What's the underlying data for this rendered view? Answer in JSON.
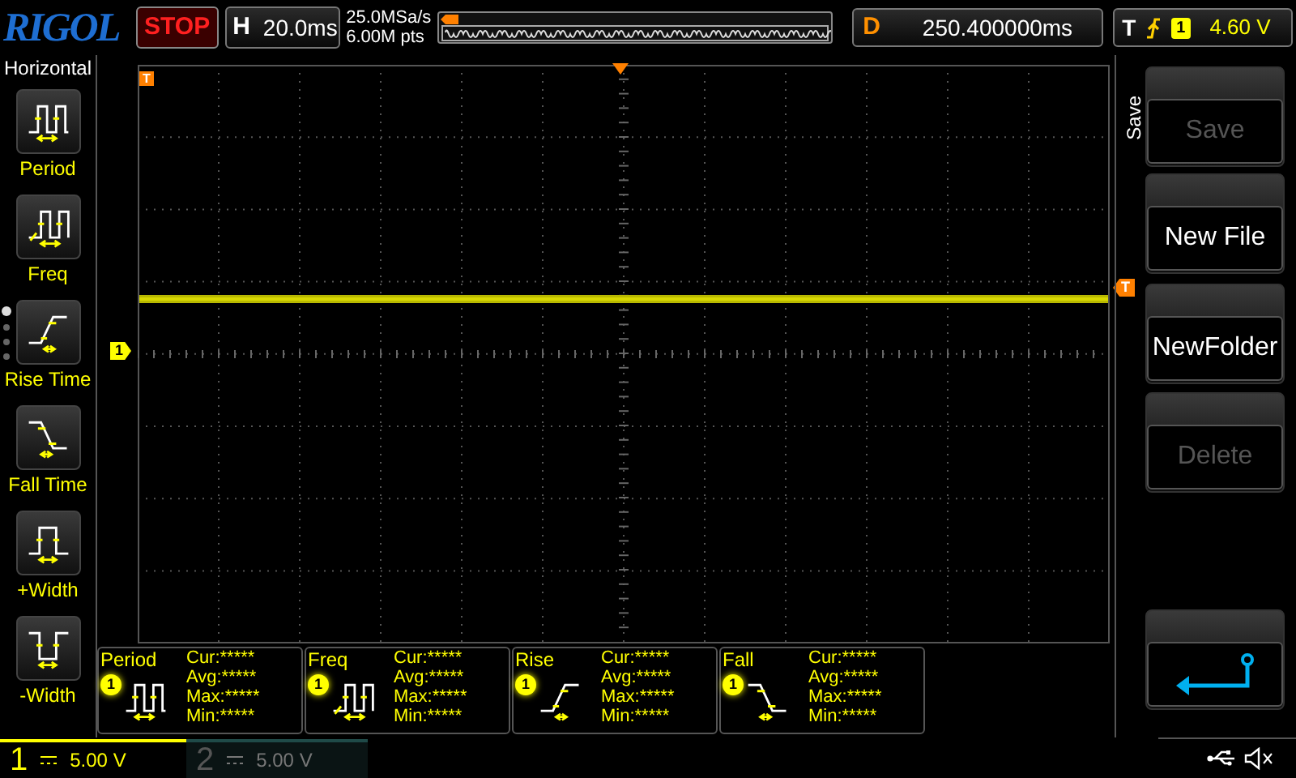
{
  "logo": "RIGOL",
  "run_state": {
    "label": "STOP"
  },
  "timebase": {
    "label": "H",
    "value": "20.0ms"
  },
  "acquisition": {
    "sample_rate": "25.0MSa/s",
    "memory_depth": "6.00M pts"
  },
  "delay": {
    "label": "D",
    "value": "250.400000ms"
  },
  "trigger": {
    "label": "T",
    "channel": "1",
    "level": "4.60 V"
  },
  "sidebar": {
    "title": "Horizontal",
    "pages": [
      {
        "selected": true
      },
      {
        "selected": false
      },
      {
        "selected": false
      },
      {
        "selected": false
      }
    ],
    "items": [
      {
        "label": "Period",
        "kind": "period"
      },
      {
        "label": "Freq",
        "kind": "freq"
      },
      {
        "label": "Rise Time",
        "kind": "rise"
      },
      {
        "label": "Fall Time",
        "kind": "fall"
      },
      {
        "label": "+Width",
        "kind": "pwidth"
      },
      {
        "label": "-Width",
        "kind": "nwidth"
      }
    ]
  },
  "grid_markers": {
    "trigger_position": "T",
    "channel": "1",
    "trigger_level": "T"
  },
  "measurements": [
    {
      "name": "Period",
      "channel": "1",
      "kind": "period",
      "stats": [
        {
          "label": "Cur:",
          "value": "*****"
        },
        {
          "label": "Avg:",
          "value": "*****"
        },
        {
          "label": "Max:",
          "value": "*****"
        },
        {
          "label": "Min:",
          "value": "*****"
        }
      ]
    },
    {
      "name": "Freq",
      "channel": "1",
      "kind": "freq",
      "stats": [
        {
          "label": "Cur:",
          "value": "*****"
        },
        {
          "label": "Avg:",
          "value": "*****"
        },
        {
          "label": "Max:",
          "value": "*****"
        },
        {
          "label": "Min:",
          "value": "*****"
        }
      ]
    },
    {
      "name": "Rise",
      "channel": "1",
      "kind": "rise",
      "stats": [
        {
          "label": "Cur:",
          "value": "*****"
        },
        {
          "label": "Avg:",
          "value": "*****"
        },
        {
          "label": "Max:",
          "value": "*****"
        },
        {
          "label": "Min:",
          "value": "*****"
        }
      ]
    },
    {
      "name": "Fall",
      "channel": "1",
      "kind": "fall",
      "stats": [
        {
          "label": "Cur:",
          "value": "*****"
        },
        {
          "label": "Avg:",
          "value": "*****"
        },
        {
          "label": "Max:",
          "value": "*****"
        },
        {
          "label": "Min:",
          "value": "*****"
        }
      ]
    }
  ],
  "menu": {
    "title": "Save",
    "buttons": [
      {
        "kind": "text",
        "label": "Save",
        "disabled": true
      },
      {
        "kind": "text",
        "label": "New File",
        "disabled": false
      },
      {
        "kind": "text",
        "label": "NewFolder",
        "disabled": false
      },
      {
        "kind": "text",
        "label": "Delete",
        "disabled": true
      },
      {
        "kind": "back"
      }
    ]
  },
  "channels": [
    {
      "number": "1",
      "scale": "5.00 V",
      "active": true
    },
    {
      "number": "2",
      "scale": "5.00 V",
      "active": false
    }
  ]
}
